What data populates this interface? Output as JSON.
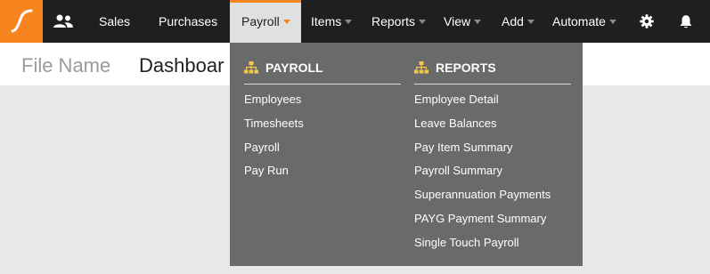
{
  "nav": {
    "items": [
      {
        "label": "Sales"
      },
      {
        "label": "Purchases"
      },
      {
        "label": "Payroll"
      },
      {
        "label": "Items"
      },
      {
        "label": "Reports"
      },
      {
        "label": "View"
      },
      {
        "label": "Add"
      },
      {
        "label": "Automate"
      }
    ],
    "accent_color": "#f6851f"
  },
  "subbar": {
    "file_name": "File Name",
    "page_title": "Dashboar"
  },
  "dropdown": {
    "payroll": {
      "heading": "PAYROLL",
      "links": [
        "Employees",
        "Timesheets",
        "Payroll",
        "Pay Run"
      ]
    },
    "reports": {
      "heading": "REPORTS",
      "links": [
        "Employee Detail",
        "Leave Balances",
        "Pay Item Summary",
        "Payroll Summary",
        "Superannuation Payments",
        "PAYG Payment Summary",
        "Single Touch Payroll"
      ]
    }
  },
  "icons": {
    "logo": "logo-icon",
    "people": "people-icon",
    "settings": "gear-icon",
    "notifications": "bell-icon",
    "section": "sitemap-icon"
  }
}
